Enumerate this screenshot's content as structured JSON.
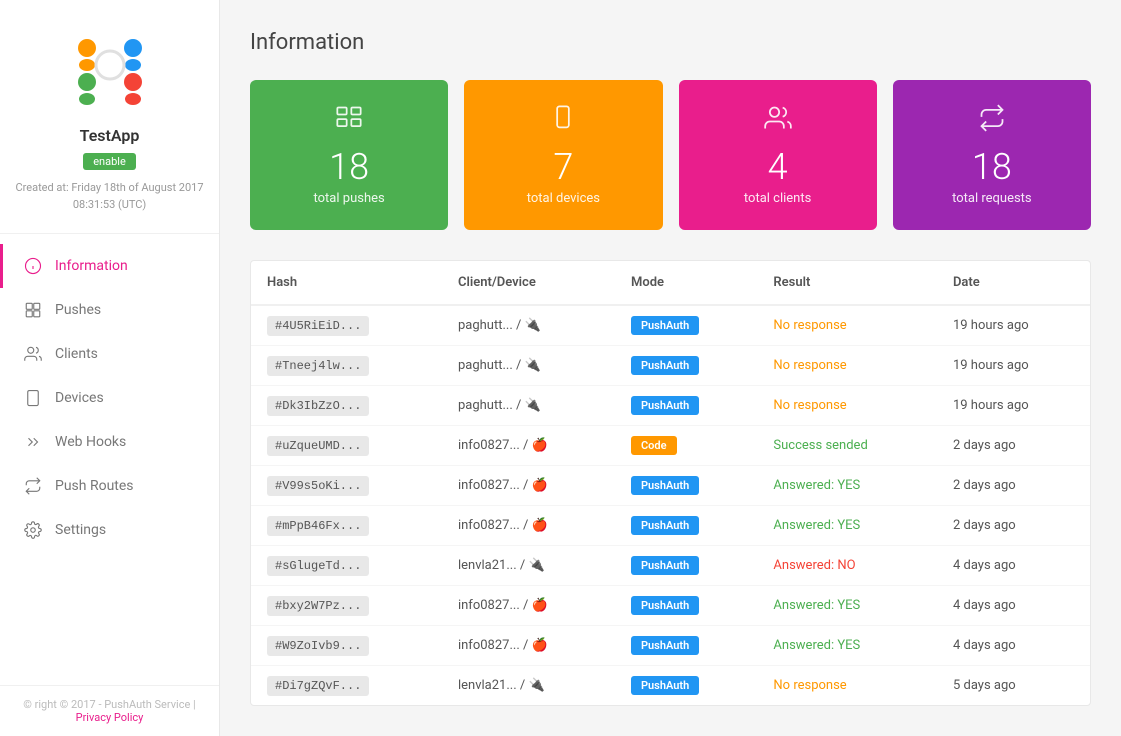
{
  "sidebar": {
    "app_name": "TestApp",
    "enable_label": "enable",
    "created_at": "Created at: Friday 18th of August 2017 08:31:53 (UTC)",
    "nav_items": [
      {
        "id": "information",
        "label": "Information",
        "icon": "info-icon",
        "active": true
      },
      {
        "id": "pushes",
        "label": "Pushes",
        "icon": "pushes-icon",
        "active": false
      },
      {
        "id": "clients",
        "label": "Clients",
        "icon": "clients-icon",
        "active": false
      },
      {
        "id": "devices",
        "label": "Devices",
        "icon": "devices-icon",
        "active": false
      },
      {
        "id": "webhooks",
        "label": "Web Hooks",
        "icon": "webhooks-icon",
        "active": false
      },
      {
        "id": "push-routes",
        "label": "Push Routes",
        "icon": "push-routes-icon",
        "active": false
      },
      {
        "id": "settings",
        "label": "Settings",
        "icon": "settings-icon",
        "active": false
      }
    ],
    "footer": "© right © 2017 - PushAuth Service |",
    "footer_link": "Privacy Policy"
  },
  "main": {
    "page_title": "Information",
    "stat_cards": [
      {
        "id": "total-pushes",
        "number": "18",
        "label": "total pushes",
        "color": "green",
        "icon": "pushes-card-icon"
      },
      {
        "id": "total-devices",
        "number": "7",
        "label": "total devices",
        "color": "orange",
        "icon": "devices-card-icon"
      },
      {
        "id": "total-clients",
        "number": "4",
        "label": "total clients",
        "color": "pink",
        "icon": "clients-card-icon"
      },
      {
        "id": "total-requests",
        "number": "18",
        "label": "total requests",
        "color": "purple",
        "icon": "requests-card-icon"
      }
    ],
    "table": {
      "columns": [
        "Hash",
        "Client/Device",
        "Mode",
        "Result",
        "Date"
      ],
      "rows": [
        {
          "hash": "#4U5RiEiD...",
          "client_device": "paghutt... / 🔌",
          "mode": "PushAuth",
          "mode_type": "pushauth",
          "result": "No response",
          "result_type": "no-response",
          "date": "19 hours ago"
        },
        {
          "hash": "#Tneej4lw...",
          "client_device": "paghutt... / 🔌",
          "mode": "PushAuth",
          "mode_type": "pushauth",
          "result": "No response",
          "result_type": "no-response",
          "date": "19 hours ago"
        },
        {
          "hash": "#Dk3IbZzO...",
          "client_device": "paghutt... / 🔌",
          "mode": "PushAuth",
          "mode_type": "pushauth",
          "result": "No response",
          "result_type": "no-response",
          "date": "19 hours ago"
        },
        {
          "hash": "#uZqueUMD...",
          "client_device": "info0827... / 🍎",
          "mode": "Code",
          "mode_type": "code",
          "result": "Success sended",
          "result_type": "success",
          "date": "2 days ago"
        },
        {
          "hash": "#V99s5oKi...",
          "client_device": "info0827... / 🍎",
          "mode": "PushAuth",
          "mode_type": "pushauth",
          "result": "Answered: YES",
          "result_type": "answered-yes",
          "date": "2 days ago"
        },
        {
          "hash": "#mPpB46Fx...",
          "client_device": "info0827... / 🍎",
          "mode": "PushAuth",
          "mode_type": "pushauth",
          "result": "Answered: YES",
          "result_type": "answered-yes",
          "date": "2 days ago"
        },
        {
          "hash": "#sGlugeTd...",
          "client_device": "lenvla21... / 🔌",
          "mode": "PushAuth",
          "mode_type": "pushauth",
          "result": "Answered: NO",
          "result_type": "answered-no",
          "date": "4 days ago"
        },
        {
          "hash": "#bxy2W7Pz...",
          "client_device": "info0827... / 🍎",
          "mode": "PushAuth",
          "mode_type": "pushauth",
          "result": "Answered: YES",
          "result_type": "answered-yes",
          "date": "4 days ago"
        },
        {
          "hash": "#W9ZoIvb9...",
          "client_device": "info0827... / 🍎",
          "mode": "PushAuth",
          "mode_type": "pushauth",
          "result": "Answered: YES",
          "result_type": "answered-yes",
          "date": "4 days ago"
        },
        {
          "hash": "#Di7gZQvF...",
          "client_device": "lenvla21... / 🔌",
          "mode": "PushAuth",
          "mode_type": "pushauth",
          "result": "No response",
          "result_type": "no-response",
          "date": "5 days ago"
        }
      ]
    }
  },
  "footer": {
    "copyright": "ight © 2017 - PushAuth Service |",
    "privacy_link": "Privacy Policy"
  }
}
